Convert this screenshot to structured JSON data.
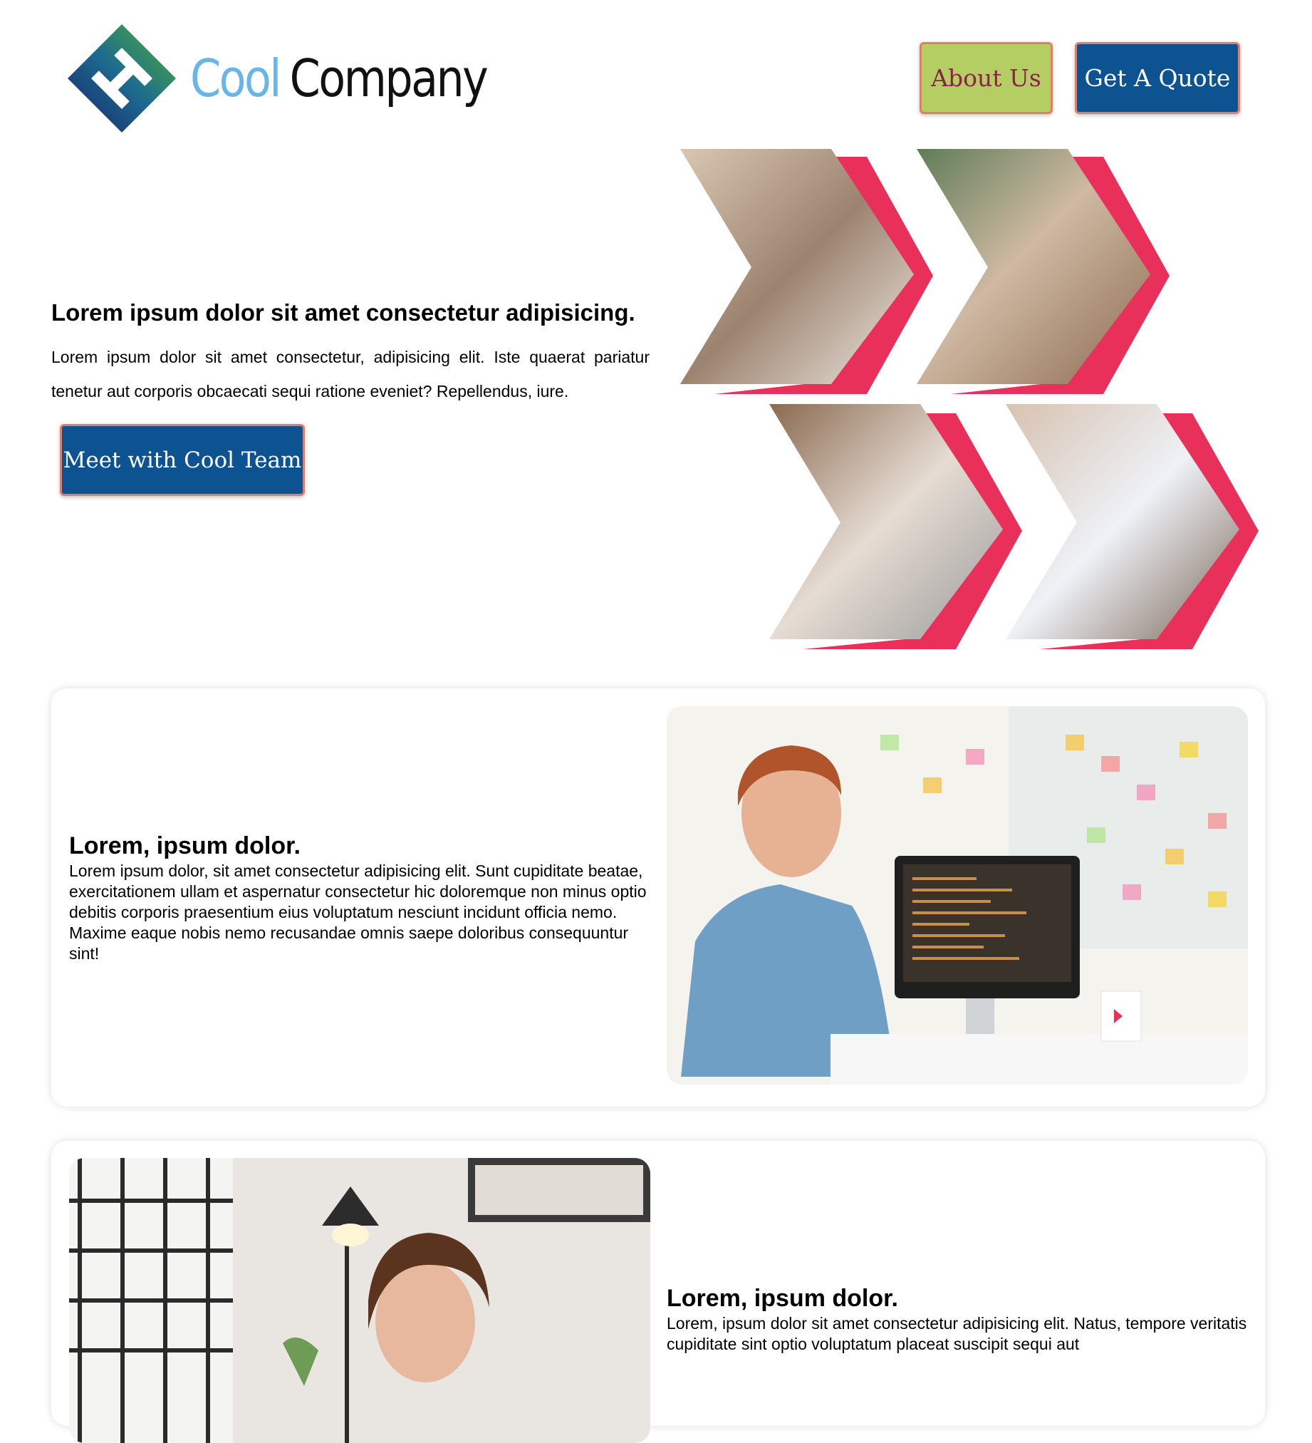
{
  "header": {
    "logo": {
      "word1": "Cool",
      "word2": "Company"
    },
    "about_label": "About Us",
    "quote_label": "Get A Quote"
  },
  "hero": {
    "title": "Lorem ipsum dolor sit amet consectetur adipisicing.",
    "text": "Lorem ipsum dolor sit amet consectetur, adipisicing elit. Iste quaerat pariatur tenetur aut corporis obcaecati sequi ratione eveniet? Repellendus, iure.",
    "cta_label": "Meet with Cool Team"
  },
  "features": [
    {
      "title": "Lorem, ipsum dolor.",
      "text": "Lorem ipsum dolor, sit amet consectetur adipisicing elit. Sunt cupiditate beatae, exercitationem ullam et aspernatur consectetur hic doloremque non minus optio debitis corporis praesentium eius voluptatum nesciunt incidunt officia nemo. Maxime eaque nobis nemo recusandae omnis saepe doloribus consequuntur sint!"
    },
    {
      "title": "Lorem, ipsum dolor.",
      "text": "Lorem, ipsum dolor sit amet consectetur adipisicing elit. Natus, tempore veritatis cupiditate sint optio voluptatum placeat suscipit sequi aut"
    }
  ],
  "colors": {
    "primary_blue": "#0d5391",
    "lime": "#b5ce64",
    "accent_red": "#e8305a",
    "logo_blue": "#6ab5e8"
  }
}
